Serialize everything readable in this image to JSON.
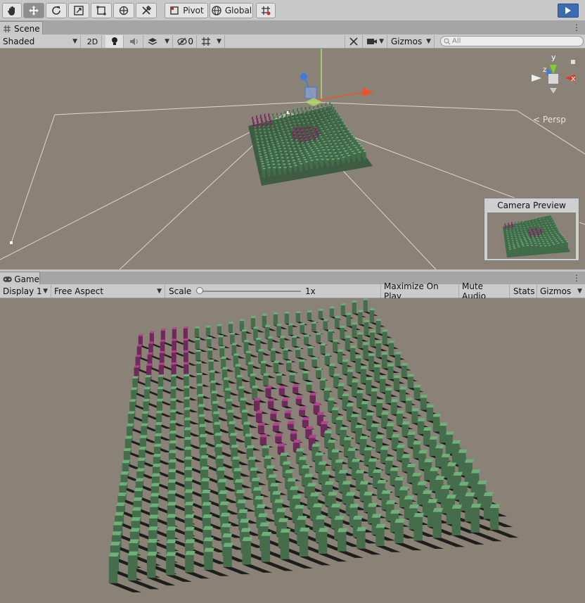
{
  "toolbar": {
    "pivot_label": "Pivot",
    "global_label": "Global"
  },
  "scene_tab": {
    "label": "Scene",
    "draw_mode": "Shaded",
    "mode_2d": "2D",
    "hidden_count": "0",
    "gizmos_label": "Gizmos",
    "search_placeholder": "All",
    "persp_label": "Persp",
    "camera_preview_title": "Camera Preview",
    "axis_x": "x",
    "axis_y": "y",
    "axis_z": "z"
  },
  "game_tab": {
    "label": "Game",
    "display": "Display 1",
    "aspect": "Free Aspect",
    "scale_label": "Scale",
    "scale_value": "1x",
    "maximize_label": "Maximize On Play",
    "mute_label": "Mute Audio",
    "stats_label": "Stats",
    "gizmos_label": "Gizmos"
  },
  "colors": {
    "cube_green": "#6fb07a",
    "cube_magenta": "#b2438f",
    "ground": "#8a8277",
    "accent_blue": "#3b6cb0"
  }
}
